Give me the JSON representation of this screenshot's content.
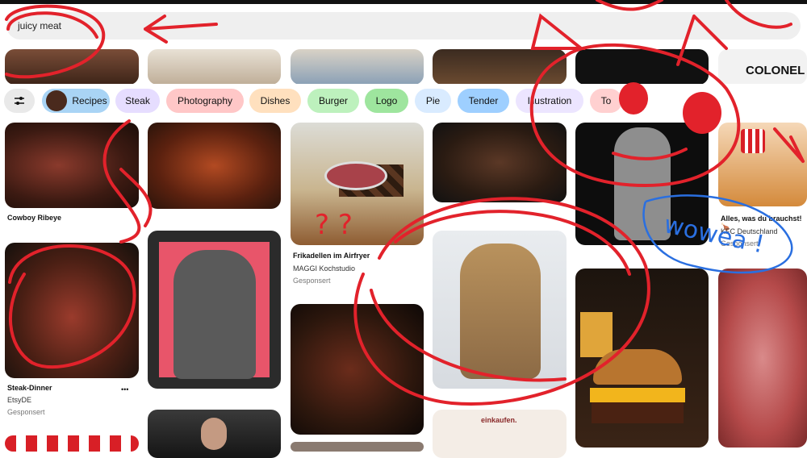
{
  "search": {
    "query": "juicy meat"
  },
  "filters": {
    "settings_icon": "sliders-icon",
    "chips": [
      {
        "label": "Recipes",
        "bg": "#a9d4f5"
      },
      {
        "label": "Steak",
        "bg": "#e6ddff"
      },
      {
        "label": "Photography",
        "bg": "#ffc7c7"
      },
      {
        "label": "Dishes",
        "bg": "#ffe0be"
      },
      {
        "label": "Burger",
        "bg": "#bdf1bd"
      },
      {
        "label": "Logo",
        "bg": "#9ee59e"
      },
      {
        "label": "Pie",
        "bg": "#d9ebff"
      },
      {
        "label": "Tender",
        "bg": "#9ecfff"
      },
      {
        "label": "Illustration",
        "bg": "#ece5ff"
      },
      {
        "label": "To",
        "bg": "#ffd0d0"
      }
    ]
  },
  "pins": {
    "cowboy": {
      "title": "Cowboy Ribeye"
    },
    "steak_dinner": {
      "title": "Steak-Dinner",
      "source": "EtsyDE",
      "sponsored": "Gesponsert",
      "more": "•••"
    },
    "frikadellen": {
      "title": "Frikadellen im Airfryer",
      "source": "MAGGI Kochstudio",
      "sponsored": "Gesponsert"
    },
    "kfc": {
      "title": "Alles, was du brauchst! 🍗",
      "source": "KFC Deutschland",
      "sponsored": "Gesponsert"
    },
    "kfc_top": {
      "text": "COLONEL"
    },
    "bottom_ad": {
      "text": "einkaufen."
    }
  },
  "doodles": {
    "text": "wowea !",
    "question": "? ?",
    "ink_color": "#e2222b",
    "blue_ink": "#2a6fe0"
  },
  "colors": {
    "search_bg": "#efefef",
    "page_bg": "#ffffff",
    "pink_frame": "#e8556a"
  }
}
